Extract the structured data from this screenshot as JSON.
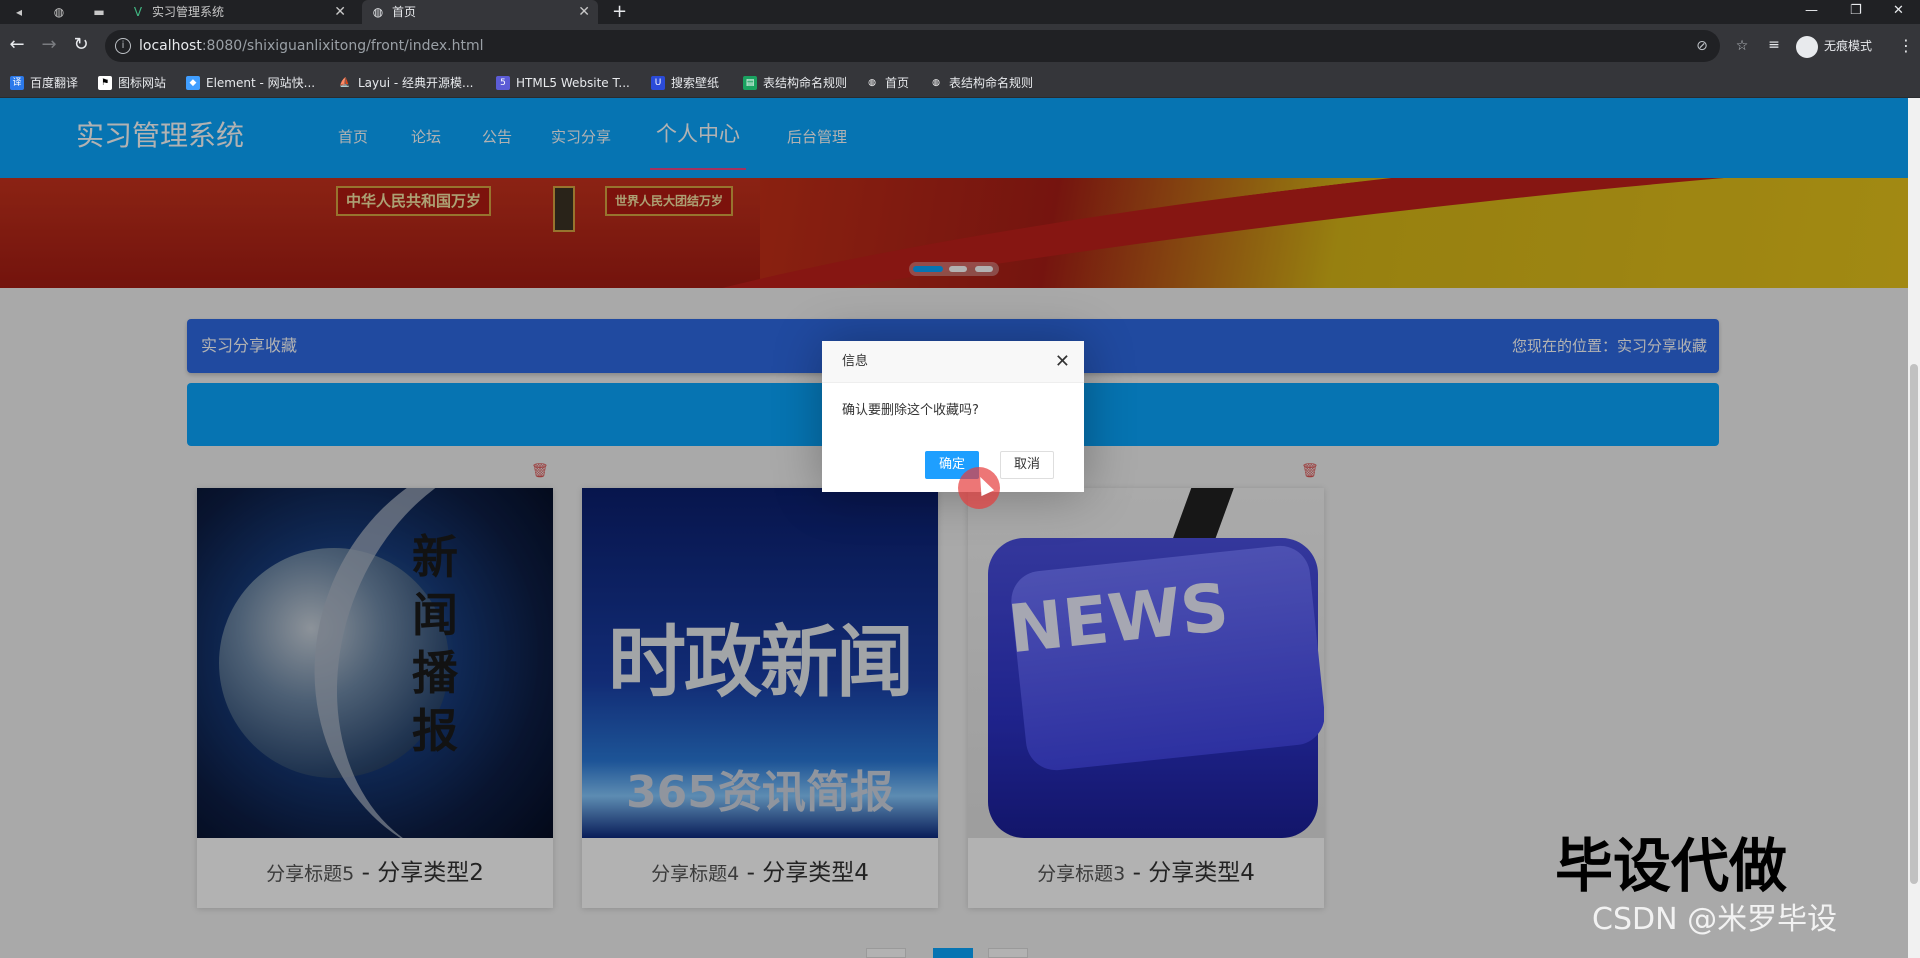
{
  "browser": {
    "tabs": [
      {
        "label": "实习管理系统",
        "active": false
      },
      {
        "label": "首页",
        "active": true
      }
    ],
    "url_host": "localhost",
    "url_rest": ":8080/shixiguanlixitong/front/index.html",
    "profile_label": "无痕模式",
    "bookmarks": [
      "百度翻译",
      "图标网站",
      "Element - 网站快...",
      "Layui - 经典开源模...",
      "HTML5 Website T...",
      "搜索壁纸",
      "表结构命名规则",
      "首页",
      "表结构命名规则"
    ]
  },
  "site": {
    "brand": "实习管理系统",
    "nav": [
      "首页",
      "论坛",
      "公告",
      "实习分享",
      "个人中心",
      "后台管理"
    ],
    "active_nav": "个人中心"
  },
  "banner": {
    "plaques": [
      "中华人民共和国万岁",
      "世界人民大团结万岁"
    ]
  },
  "breadcrumb": {
    "title": "实习分享收藏",
    "location": "您现在的位置：实习分享收藏"
  },
  "cards": [
    {
      "title": "分享标题5",
      "type": "分享类型2",
      "image_text": "新闻播报"
    },
    {
      "title": "分享标题4",
      "type": "分享类型4",
      "image_text": "时政新闻",
      "image_subtext": "365资讯简报"
    },
    {
      "title": "分享标题3",
      "type": "分享类型4",
      "image_text": "NEWS"
    }
  ],
  "dialog": {
    "title": "信息",
    "message": "确认要删除这个收藏吗?",
    "ok": "确定",
    "cancel": "取消"
  },
  "watermark": {
    "big": "毕设代做",
    "csdn": "CSDN @米罗毕设"
  },
  "colors": {
    "nav_bg": "#0aa6ff",
    "crumb_bg": "#2e6be6",
    "dialog_ok": "#1e9fff",
    "trash": "#e05555"
  }
}
